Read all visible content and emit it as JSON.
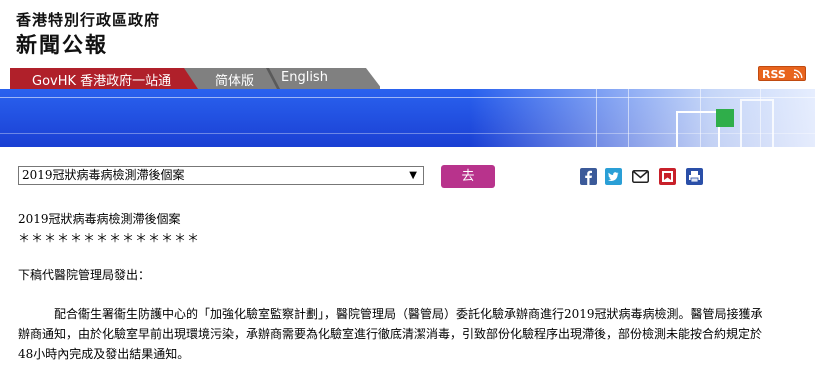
{
  "header": {
    "gov_name": "香港特別行政區政府",
    "press_title": "新聞公報"
  },
  "nav": {
    "govhk": "GovHK 香港政府一站通",
    "simplified": "简体版",
    "english": "English",
    "rss": "RSS"
  },
  "toolbar": {
    "select_value": "2019冠狀病毒病檢測滯後個案",
    "go_label": "去",
    "share_icons": [
      "facebook-icon",
      "twitter-icon",
      "email-icon",
      "bookmark-icon",
      "print-icon"
    ]
  },
  "article": {
    "title": "2019冠狀病毒病檢測滯後個案",
    "stars": "＊＊＊＊＊＊＊＊＊＊＊＊＊＊",
    "byline": "下稿代醫院管理局發出：",
    "body": "配合衞生署衞生防護中心的「加強化驗室監察計劃」，醫院管理局（醫管局）委託化驗承辦商進行2019冠狀病毒病檢測。醫管局接獲承辦商通知，由於化驗室早前出現環境污染，承辦商需要為化驗室進行徹底清潔消毒，引致部份化驗程序出現滯後，部份檢測未能按合約規定於48小時內完成及發出結果通知。"
  },
  "colors": {
    "nav_red": "#b0202a",
    "nav_gray": "#808080",
    "banner_blue": "#1a3fd3",
    "go_button": "#b8338c",
    "rss_orange": "#e8641e"
  }
}
